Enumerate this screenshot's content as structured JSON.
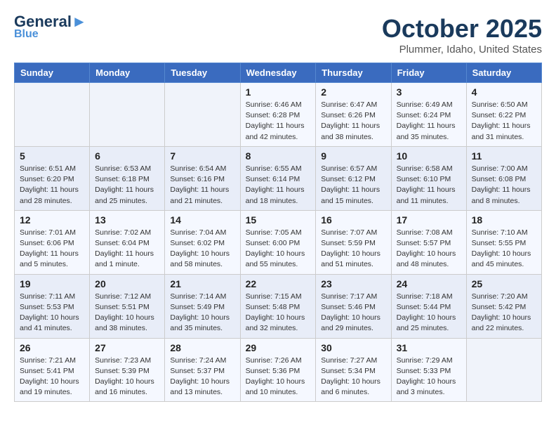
{
  "logo": {
    "line1a": "General",
    "line1b": "▲",
    "line2": "Blue"
  },
  "title": "October 2025",
  "location": "Plummer, Idaho, United States",
  "weekdays": [
    "Sunday",
    "Monday",
    "Tuesday",
    "Wednesday",
    "Thursday",
    "Friday",
    "Saturday"
  ],
  "weeks": [
    [
      {
        "day": "",
        "info": ""
      },
      {
        "day": "",
        "info": ""
      },
      {
        "day": "",
        "info": ""
      },
      {
        "day": "1",
        "info": "Sunrise: 6:46 AM\nSunset: 6:28 PM\nDaylight: 11 hours\nand 42 minutes."
      },
      {
        "day": "2",
        "info": "Sunrise: 6:47 AM\nSunset: 6:26 PM\nDaylight: 11 hours\nand 38 minutes."
      },
      {
        "day": "3",
        "info": "Sunrise: 6:49 AM\nSunset: 6:24 PM\nDaylight: 11 hours\nand 35 minutes."
      },
      {
        "day": "4",
        "info": "Sunrise: 6:50 AM\nSunset: 6:22 PM\nDaylight: 11 hours\nand 31 minutes."
      }
    ],
    [
      {
        "day": "5",
        "info": "Sunrise: 6:51 AM\nSunset: 6:20 PM\nDaylight: 11 hours\nand 28 minutes."
      },
      {
        "day": "6",
        "info": "Sunrise: 6:53 AM\nSunset: 6:18 PM\nDaylight: 11 hours\nand 25 minutes."
      },
      {
        "day": "7",
        "info": "Sunrise: 6:54 AM\nSunset: 6:16 PM\nDaylight: 11 hours\nand 21 minutes."
      },
      {
        "day": "8",
        "info": "Sunrise: 6:55 AM\nSunset: 6:14 PM\nDaylight: 11 hours\nand 18 minutes."
      },
      {
        "day": "9",
        "info": "Sunrise: 6:57 AM\nSunset: 6:12 PM\nDaylight: 11 hours\nand 15 minutes."
      },
      {
        "day": "10",
        "info": "Sunrise: 6:58 AM\nSunset: 6:10 PM\nDaylight: 11 hours\nand 11 minutes."
      },
      {
        "day": "11",
        "info": "Sunrise: 7:00 AM\nSunset: 6:08 PM\nDaylight: 11 hours\nand 8 minutes."
      }
    ],
    [
      {
        "day": "12",
        "info": "Sunrise: 7:01 AM\nSunset: 6:06 PM\nDaylight: 11 hours\nand 5 minutes."
      },
      {
        "day": "13",
        "info": "Sunrise: 7:02 AM\nSunset: 6:04 PM\nDaylight: 11 hours\nand 1 minute."
      },
      {
        "day": "14",
        "info": "Sunrise: 7:04 AM\nSunset: 6:02 PM\nDaylight: 10 hours\nand 58 minutes."
      },
      {
        "day": "15",
        "info": "Sunrise: 7:05 AM\nSunset: 6:00 PM\nDaylight: 10 hours\nand 55 minutes."
      },
      {
        "day": "16",
        "info": "Sunrise: 7:07 AM\nSunset: 5:59 PM\nDaylight: 10 hours\nand 51 minutes."
      },
      {
        "day": "17",
        "info": "Sunrise: 7:08 AM\nSunset: 5:57 PM\nDaylight: 10 hours\nand 48 minutes."
      },
      {
        "day": "18",
        "info": "Sunrise: 7:10 AM\nSunset: 5:55 PM\nDaylight: 10 hours\nand 45 minutes."
      }
    ],
    [
      {
        "day": "19",
        "info": "Sunrise: 7:11 AM\nSunset: 5:53 PM\nDaylight: 10 hours\nand 41 minutes."
      },
      {
        "day": "20",
        "info": "Sunrise: 7:12 AM\nSunset: 5:51 PM\nDaylight: 10 hours\nand 38 minutes."
      },
      {
        "day": "21",
        "info": "Sunrise: 7:14 AM\nSunset: 5:49 PM\nDaylight: 10 hours\nand 35 minutes."
      },
      {
        "day": "22",
        "info": "Sunrise: 7:15 AM\nSunset: 5:48 PM\nDaylight: 10 hours\nand 32 minutes."
      },
      {
        "day": "23",
        "info": "Sunrise: 7:17 AM\nSunset: 5:46 PM\nDaylight: 10 hours\nand 29 minutes."
      },
      {
        "day": "24",
        "info": "Sunrise: 7:18 AM\nSunset: 5:44 PM\nDaylight: 10 hours\nand 25 minutes."
      },
      {
        "day": "25",
        "info": "Sunrise: 7:20 AM\nSunset: 5:42 PM\nDaylight: 10 hours\nand 22 minutes."
      }
    ],
    [
      {
        "day": "26",
        "info": "Sunrise: 7:21 AM\nSunset: 5:41 PM\nDaylight: 10 hours\nand 19 minutes."
      },
      {
        "day": "27",
        "info": "Sunrise: 7:23 AM\nSunset: 5:39 PM\nDaylight: 10 hours\nand 16 minutes."
      },
      {
        "day": "28",
        "info": "Sunrise: 7:24 AM\nSunset: 5:37 PM\nDaylight: 10 hours\nand 13 minutes."
      },
      {
        "day": "29",
        "info": "Sunrise: 7:26 AM\nSunset: 5:36 PM\nDaylight: 10 hours\nand 10 minutes."
      },
      {
        "day": "30",
        "info": "Sunrise: 7:27 AM\nSunset: 5:34 PM\nDaylight: 10 hours\nand 6 minutes."
      },
      {
        "day": "31",
        "info": "Sunrise: 7:29 AM\nSunset: 5:33 PM\nDaylight: 10 hours\nand 3 minutes."
      },
      {
        "day": "",
        "info": ""
      }
    ]
  ]
}
